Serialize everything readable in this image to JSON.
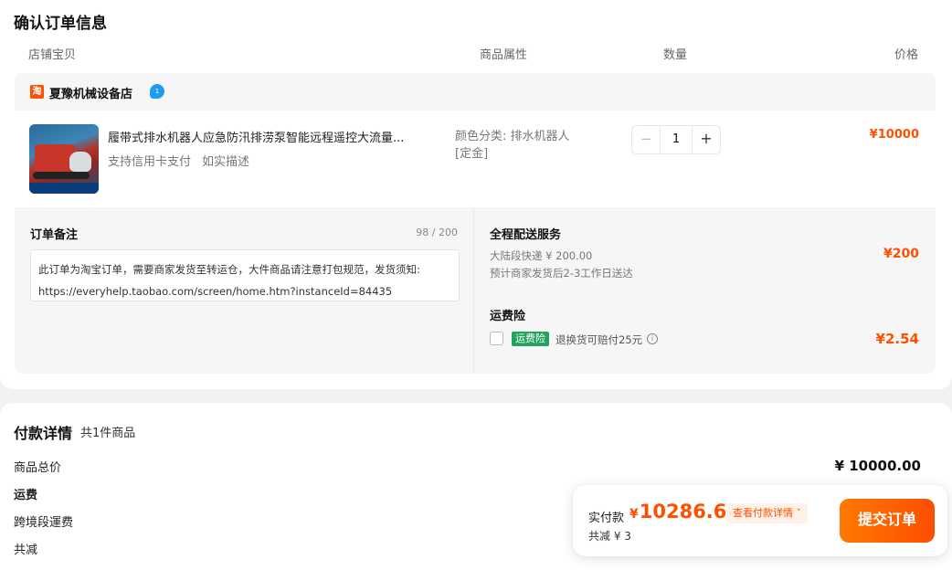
{
  "section_title": "确认订单信息",
  "columns": {
    "shop_item": "店铺宝贝",
    "attributes": "商品属性",
    "quantity": "数量",
    "price": "价格"
  },
  "shop": {
    "logo_char": "淘",
    "name": "夏豫机械设备店",
    "badge": "1"
  },
  "item": {
    "title": "履带式排水机器人应急防汛排涝泵智能远程遥控大流量...",
    "tags": [
      "支持信用卡支付",
      "如实描述"
    ],
    "attribute_line1": "颜色分类: 排水机器人",
    "attribute_line2": "[定金]",
    "quantity": "1",
    "minus": "−",
    "plus": "+",
    "price": "¥10000"
  },
  "remark": {
    "title": "订单备注",
    "count": "98 / 200",
    "text": "此订单为淘宝订单，需要商家发货至转运仓，大件商品请注意打包规范，发货须知: https://everyhelp.taobao.com/screen/home.htm?instanceId=84435"
  },
  "shipping": {
    "title": "全程配送服务",
    "line1": "大陆段快递 ¥ 200.00",
    "line2": "预计商家发货后2-3工作日送达",
    "price": "¥200"
  },
  "insurance": {
    "title": "运费险",
    "tag": "运费险",
    "text": "退换货可赔付25元",
    "info_icon": "i",
    "price": "¥2.54"
  },
  "payment": {
    "title": "付款详情",
    "count": "共1件商品",
    "rows": [
      "商品总价",
      "运费",
      "跨境段運费",
      "共减"
    ],
    "total": "¥ 10000.00"
  },
  "bar": {
    "label": "实付款",
    "yen": "¥",
    "amount": "10286.60",
    "detail": "查看付款详情 ˅",
    "discount": "共减 ¥ 3",
    "submit": "提交订单"
  },
  "colors": {
    "accent": "#ff5000",
    "insurance_tag": "#21a35d",
    "shop_badge": "#1f9cf0"
  }
}
